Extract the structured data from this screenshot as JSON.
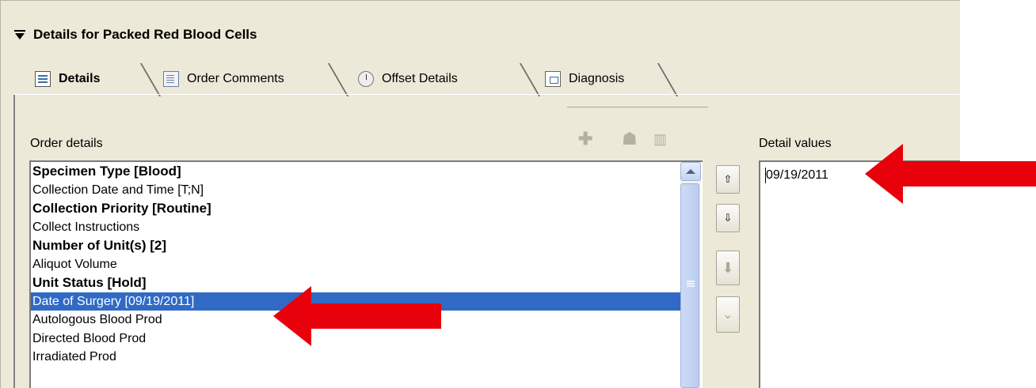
{
  "section": {
    "title": "Details for Packed Red Blood Cells"
  },
  "tabs": [
    {
      "label": "Details",
      "icon": "details-icon",
      "active": true
    },
    {
      "label": "Order Comments",
      "icon": "comments-icon"
    },
    {
      "label": "Offset Details",
      "icon": "clock-icon"
    },
    {
      "label": "Diagnosis",
      "icon": "diagnosis-icon"
    }
  ],
  "order_details": {
    "label": "Order details",
    "items": [
      {
        "text": "Specimen Type   [Blood]",
        "bold": true
      },
      {
        "text": "Collection Date and Time   [T;N]"
      },
      {
        "text": "Collection Priority   [Routine]",
        "bold": true
      },
      {
        "text": "Collect Instructions"
      },
      {
        "text": "Number of Unit(s)   [2]",
        "bold": true
      },
      {
        "text": "Aliquot Volume"
      },
      {
        "text": "Unit Status   [Hold]",
        "bold": true
      },
      {
        "text": "Date of Surgery   [09/19/2011]",
        "selected": true
      },
      {
        "text": "Autologous Blood Prod"
      },
      {
        "text": "Directed Blood Prod"
      },
      {
        "text": "Irradiated Prod"
      }
    ]
  },
  "detail_values": {
    "label": "Detail values",
    "value": "09/19/2011"
  },
  "colors": {
    "selection": "#316ac5",
    "arrow": "#e8000b",
    "panel": "#ece9d8"
  }
}
